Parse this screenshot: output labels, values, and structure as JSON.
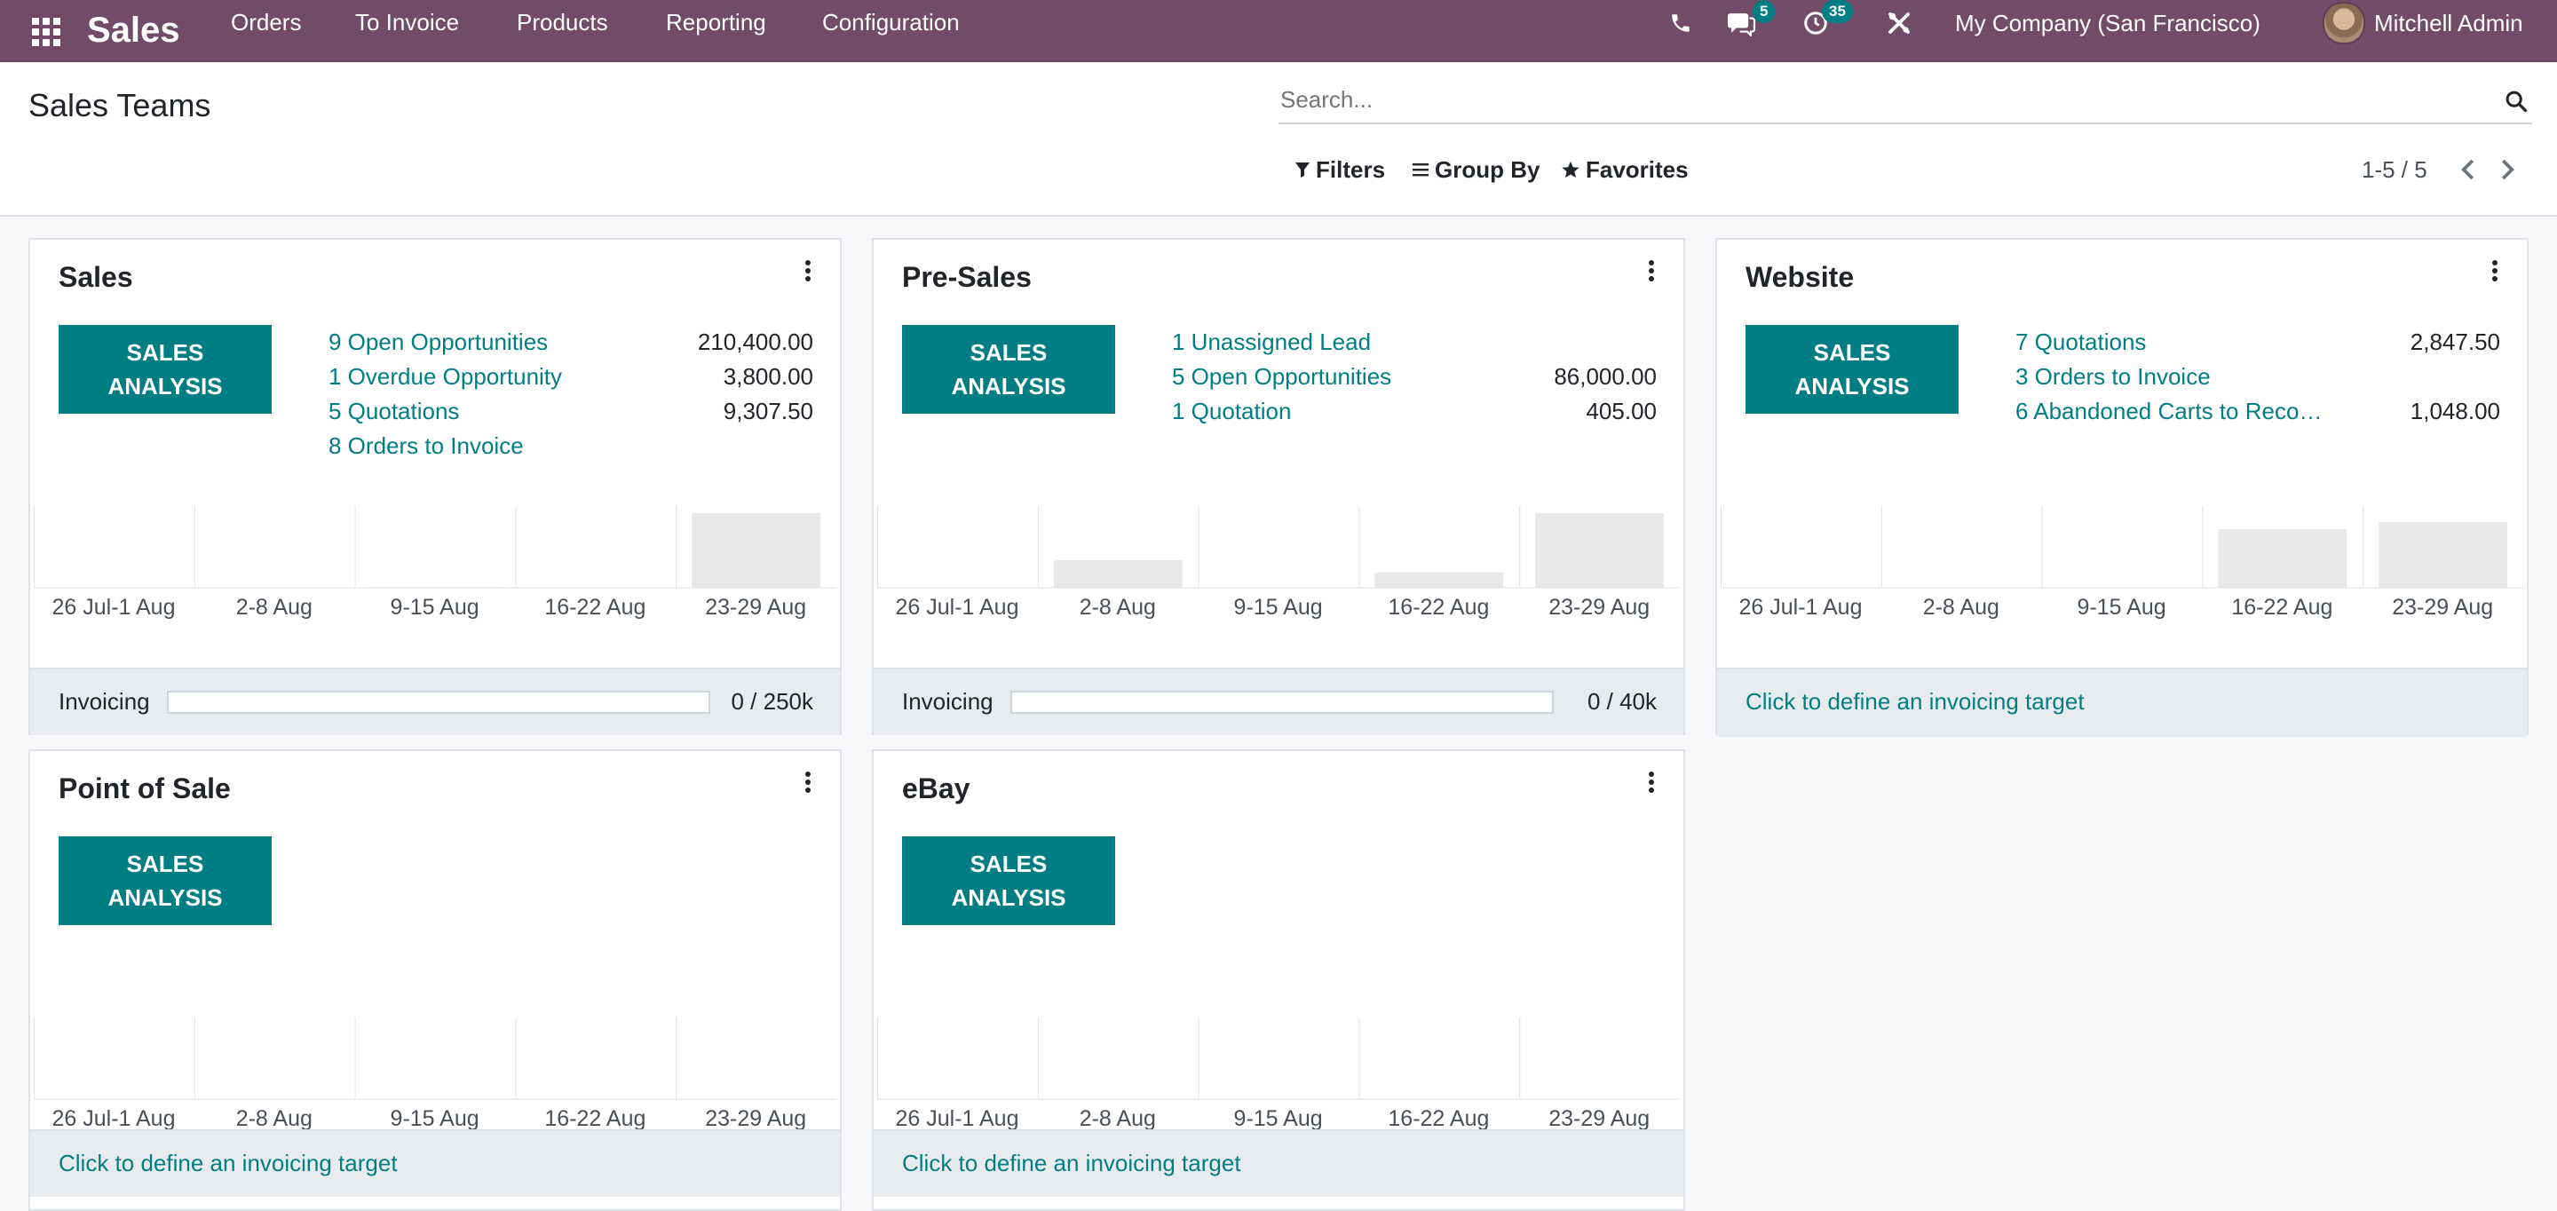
{
  "navbar": {
    "brand": "Sales",
    "menu": [
      "Orders",
      "To Invoice",
      "Products",
      "Reporting",
      "Configuration"
    ],
    "messages_count": "5",
    "activities_count": "35",
    "company": "My Company (San Francisco)",
    "user": "Mitchell Admin"
  },
  "control_panel": {
    "title": "Sales Teams",
    "search_placeholder": "Search...",
    "filters_label": "Filters",
    "group_by_label": "Group By",
    "favorites_label": "Favorites",
    "pager": "1-5 / 5"
  },
  "analysis_label": "SALES ANALYSIS",
  "week_labels": [
    "26 Jul-1 Aug",
    "2-8 Aug",
    "9-15 Aug",
    "16-22 Aug",
    "23-29 Aug"
  ],
  "define_target_label": "Click to define an invoicing target",
  "invoicing_label": "Invoicing",
  "teams": [
    {
      "name": "Sales",
      "stats": [
        {
          "label": "9 Open Opportunities",
          "value": "210,400.00"
        },
        {
          "label": "1 Overdue Opportunity",
          "value": "3,800.00"
        },
        {
          "label": "5 Quotations",
          "value": "9,307.50"
        },
        {
          "label": "8 Orders to Invoice",
          "value": ""
        }
      ],
      "bars": [
        0,
        0,
        0.01,
        0,
        1.0
      ],
      "invoicing": {
        "value": "0 / 250k",
        "progress": 0
      }
    },
    {
      "name": "Pre-Sales",
      "stats": [
        {
          "label": "1 Unassigned Lead",
          "value": ""
        },
        {
          "label": "5 Open Opportunities",
          "value": "86,000.00"
        },
        {
          "label": "1 Quotation",
          "value": "405.00"
        }
      ],
      "bars": [
        0,
        0.37,
        0,
        0.2,
        1.0
      ],
      "invoicing": {
        "value": "0 / 40k",
        "progress": 0
      }
    },
    {
      "name": "Website",
      "stats": [
        {
          "label": "7 Quotations",
          "value": "2,847.50"
        },
        {
          "label": "3 Orders to Invoice",
          "value": ""
        },
        {
          "label": "6 Abandoned Carts to Reco…",
          "value": "1,048.00"
        }
      ],
      "bars": [
        0,
        0,
        0,
        0.78,
        0.88
      ],
      "invoicing": null
    },
    {
      "name": "Point of Sale",
      "stats": [],
      "bars": [
        0,
        0,
        0,
        0,
        0
      ],
      "invoicing": null
    },
    {
      "name": "eBay",
      "stats": [],
      "bars": [
        0,
        0,
        0,
        0,
        0
      ],
      "invoicing": null
    }
  ]
}
